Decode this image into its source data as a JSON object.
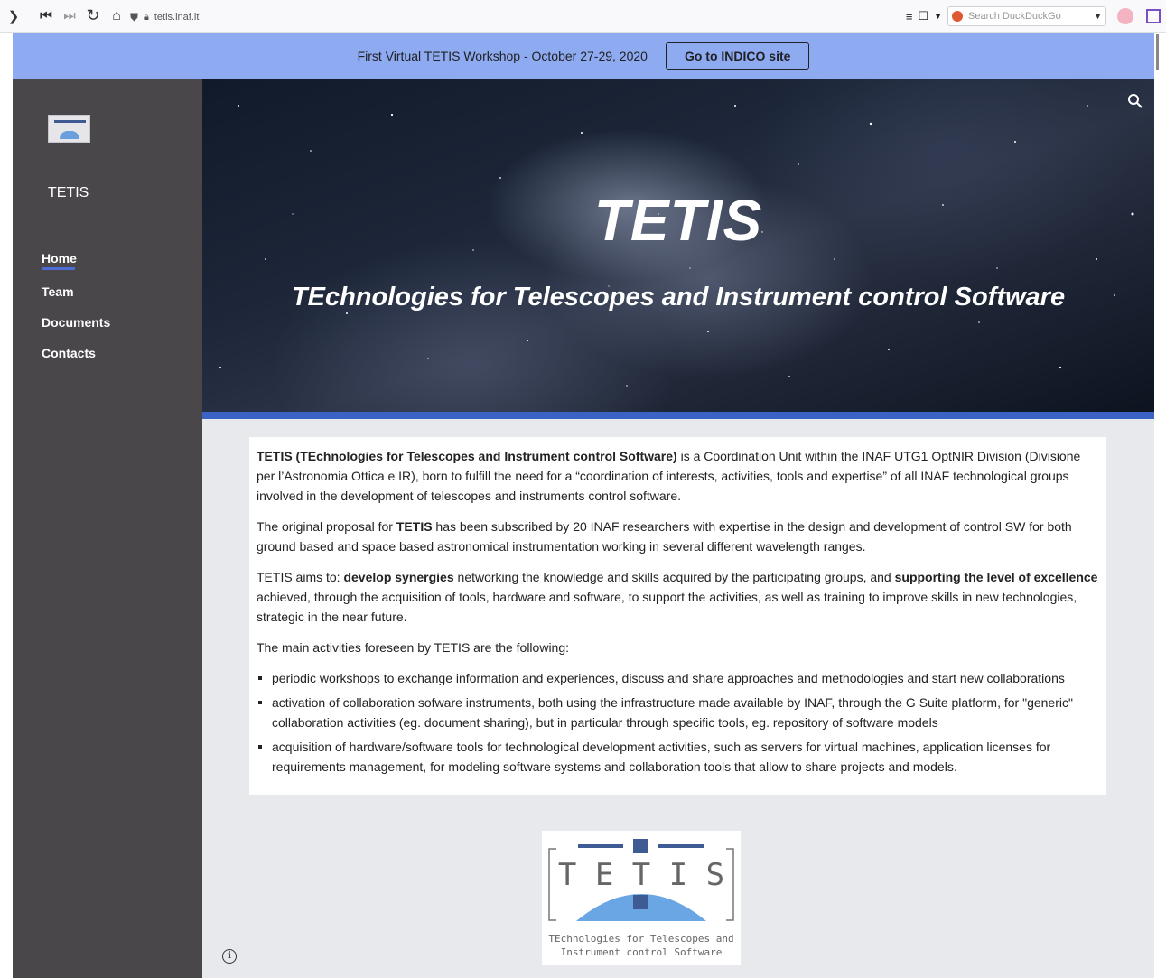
{
  "browser": {
    "url_host": "tetis.inaf.it",
    "search_placeholder": "Search DuckDuckGo"
  },
  "banner": {
    "text": "First Virtual TETIS Workshop - October 27-29, 2020",
    "button_label": "Go to INDICO site"
  },
  "sidebar": {
    "site_title": "TETIS",
    "nav": [
      {
        "label": "Home",
        "active": true
      },
      {
        "label": "Team"
      },
      {
        "label": "Documents"
      },
      {
        "label": "Contacts"
      }
    ]
  },
  "hero": {
    "title": "TETIS",
    "subtitle": "TEchnologies for Telescopes and Instrument control Software"
  },
  "content": {
    "p1_bold": "TETIS (TEchnologies for Telescopes and Instrument control Software)",
    "p1_rest": " is a Coordination Unit within the INAF UTG1 OptNIR Division (Divisione per l’Astronomia Ottica e IR), born to fulfill the need for a “coordination of interests, activities, tools and expertise” of all INAF technological groups involved in the development of telescopes and instruments control software.",
    "p2_start": "The original proposal for ",
    "p2_bold": "TETIS",
    "p2_rest": " has been subscribed by 20 INAF researchers with expertise in the design and development of control SW for both ground based and space based astronomical instrumentation working in several different wavelength ranges.",
    "p3_start": "TETIS aims to: ",
    "p3_bold1": "develop synergies",
    "p3_mid": " networking the knowledge and skills acquired by the participating groups, and ",
    "p3_bold2": "supporting the level of excellence",
    "p3_rest": " achieved, through the acquisition of tools, hardware and software, to support the activities, as well as training to improve skills in new technologies, strategic in the near future.",
    "p4": "The main activities foreseen by TETIS are the following:",
    "activities": [
      "periodic workshops to exchange information and experiences, discuss and share approaches and methodologies and start new collaborations",
      "activation of collaboration sofware instruments, both using the infrastructure made available by INAF, through the G Suite platform, for \"generic\" collaboration activities (eg. document sharing), but in particular through specific tools, eg. repository of software models",
      "acquisition of hardware/software tools for technological development activities, such as servers for virtual machines, application licenses for requirements management, for modeling software systems and collaboration tools that allow to share projects and models."
    ]
  },
  "logo": {
    "letters": "T E T I S",
    "caption_line1": "TEchnologies for Telescopes and",
    "caption_line2": "Instrument control Software"
  },
  "colors": {
    "banner_bg": "#8eaaf0",
    "sidebar_bg": "#4a474a",
    "accent": "#3a63c5",
    "main_bg": "#e8e9ec"
  },
  "icons": [
    "back-icon",
    "first-icon",
    "last-icon",
    "reload-icon",
    "home-icon",
    "shield-icon",
    "lock-icon",
    "reader-icon",
    "bookmark-icon",
    "duckduckgo-icon",
    "extension-icon",
    "search-icon",
    "info-icon"
  ]
}
